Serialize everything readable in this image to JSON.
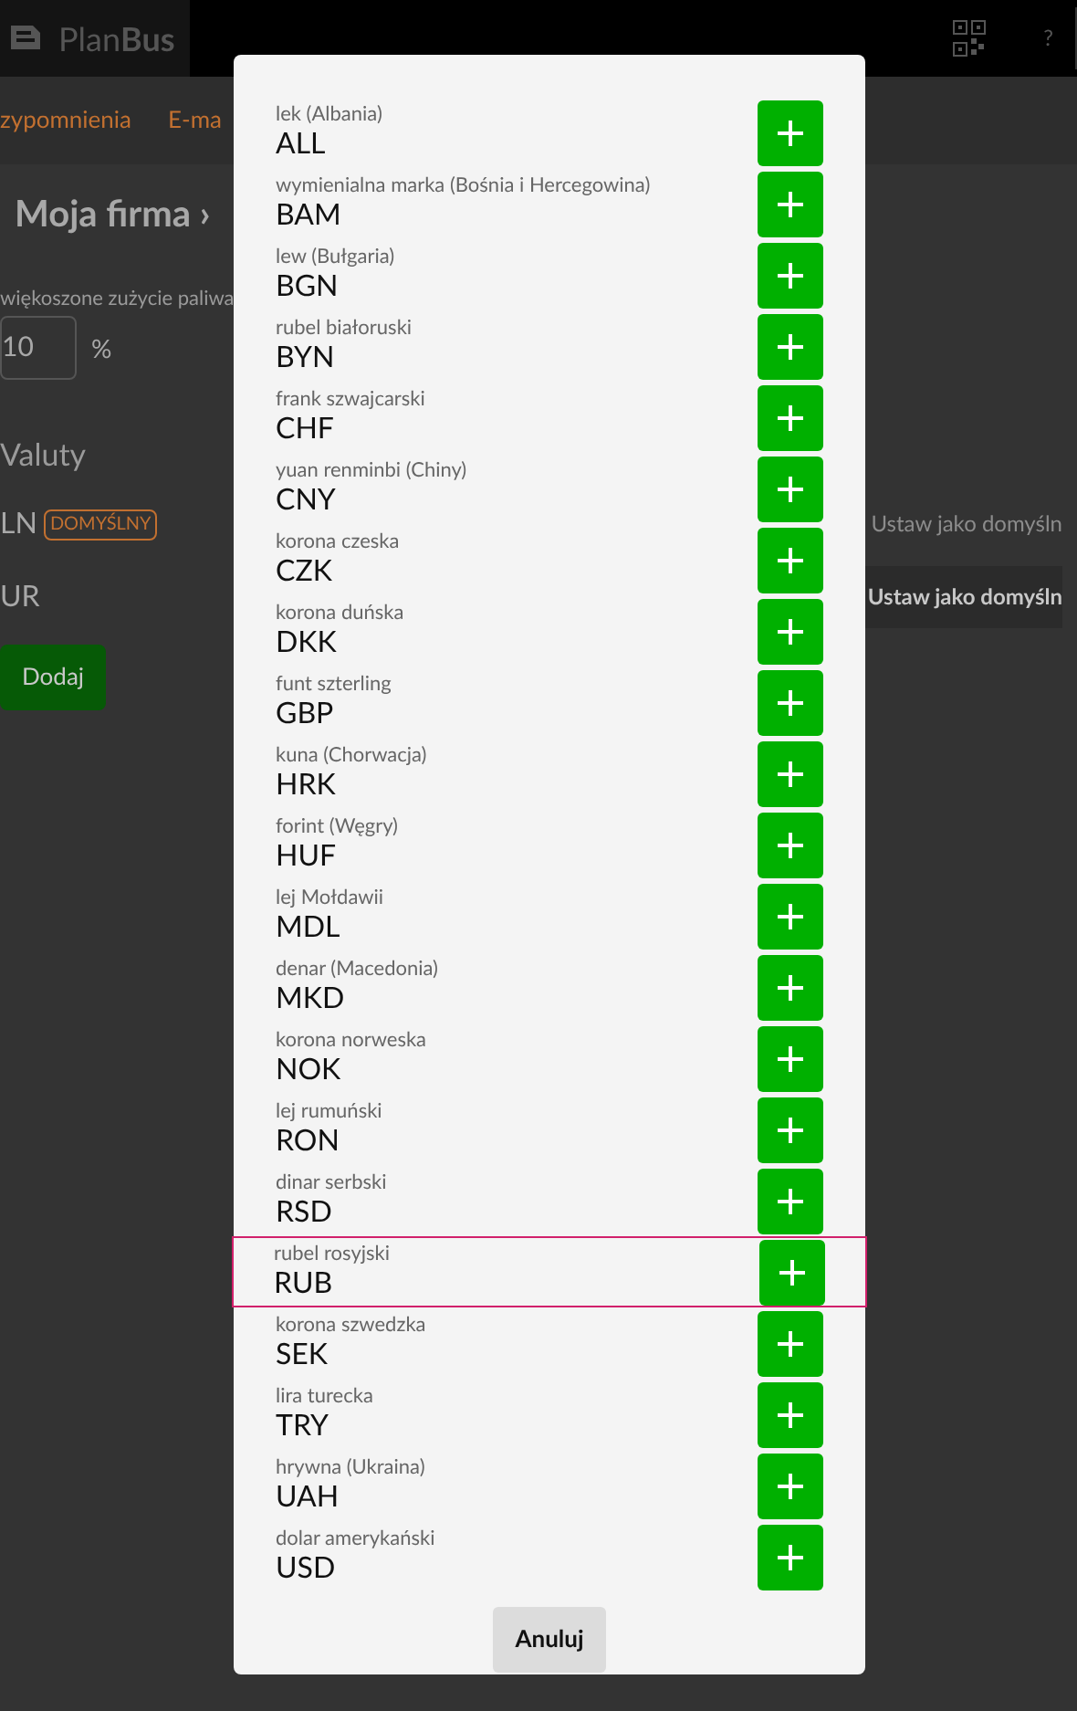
{
  "header": {
    "logo_light": "Plan",
    "logo_bold": "Bus",
    "help": "?"
  },
  "nav": [
    "zypomnienia",
    "E-ma"
  ],
  "title": "Moja firma ›",
  "fuel": {
    "label": "więkoszone zużycie paliwa",
    "value": "10",
    "unit": "%"
  },
  "currencies_heading": "Valuty",
  "currencies": [
    {
      "code": "LN",
      "badge": "DOMYŚLNY",
      "action": "Ustaw jako domyśln",
      "disabled": true
    },
    {
      "code": "UR",
      "action": "Ustaw jako domyśln",
      "disabled": false
    }
  ],
  "add_button": "Dodaj",
  "dialog": {
    "items": [
      {
        "name": "lek (Albania)",
        "code": "ALL",
        "selected": false
      },
      {
        "name": "wymienialna marka (Bośnia i Hercegowina)",
        "code": "BAM",
        "selected": false
      },
      {
        "name": "lew (Bułgaria)",
        "code": "BGN",
        "selected": false
      },
      {
        "name": "rubel białoruski",
        "code": "BYN",
        "selected": false
      },
      {
        "name": "frank szwajcarski",
        "code": "CHF",
        "selected": false
      },
      {
        "name": "yuan renminbi (Chiny)",
        "code": "CNY",
        "selected": false
      },
      {
        "name": "korona czeska",
        "code": "CZK",
        "selected": false
      },
      {
        "name": "korona duńska",
        "code": "DKK",
        "selected": false
      },
      {
        "name": "funt szterling",
        "code": "GBP",
        "selected": false
      },
      {
        "name": "kuna (Chorwacja)",
        "code": "HRK",
        "selected": false
      },
      {
        "name": "forint (Węgry)",
        "code": "HUF",
        "selected": false
      },
      {
        "name": "lej Mołdawii",
        "code": "MDL",
        "selected": false
      },
      {
        "name": "denar (Macedonia)",
        "code": "MKD",
        "selected": false
      },
      {
        "name": "korona norweska",
        "code": "NOK",
        "selected": false
      },
      {
        "name": "lej rumuński",
        "code": "RON",
        "selected": false
      },
      {
        "name": "dinar serbski",
        "code": "RSD",
        "selected": false
      },
      {
        "name": "rubel rosyjski",
        "code": "RUB",
        "selected": true
      },
      {
        "name": "korona szwedzka",
        "code": "SEK",
        "selected": false
      },
      {
        "name": "lira turecka",
        "code": "TRY",
        "selected": false
      },
      {
        "name": "hrywna (Ukraina)",
        "code": "UAH",
        "selected": false
      },
      {
        "name": "dolar amerykański",
        "code": "USD",
        "selected": false
      }
    ],
    "cancel": "Anuluj"
  }
}
